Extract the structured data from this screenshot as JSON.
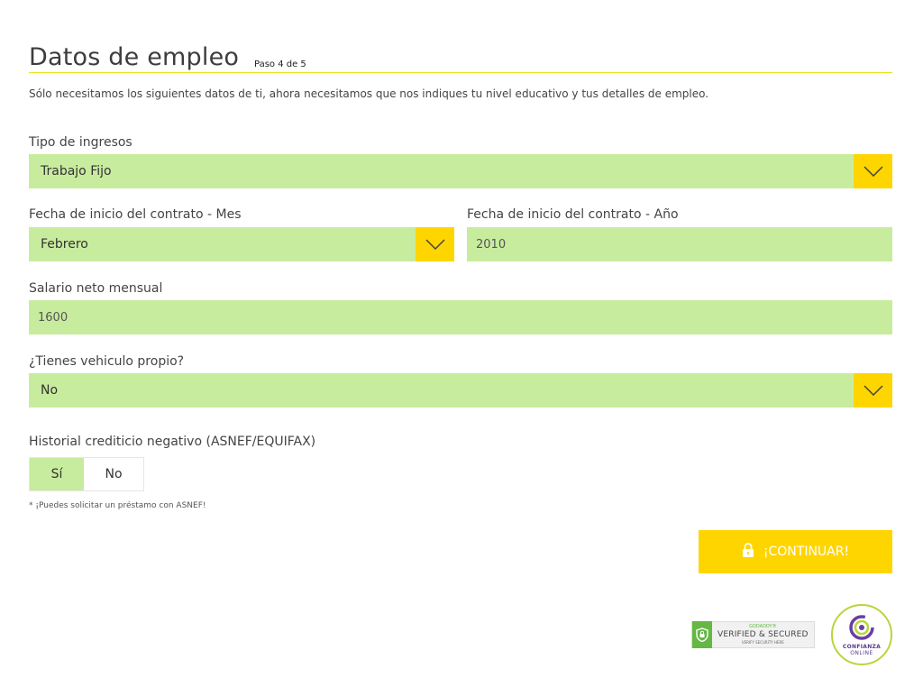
{
  "header": {
    "title": "Datos de empleo",
    "step": "Paso 4 de 5",
    "intro": "Sólo necesitamos los siguientes datos de ti, ahora necesitamos que nos indiques tu nivel educativo y tus detalles de empleo."
  },
  "form": {
    "tipo_ingresos": {
      "label": "Tipo de ingresos",
      "value": "Trabajo Fijo"
    },
    "mes_inicio": {
      "label": "Fecha de inicio del contrato - Mes",
      "value": "Febrero"
    },
    "anio_inicio": {
      "label": "Fecha de inicio del contrato - Año",
      "value": "2010"
    },
    "salario": {
      "label": "Salario neto mensual",
      "value": "1600"
    },
    "vehiculo": {
      "label": "¿Tienes vehiculo propio?",
      "value": "No"
    },
    "historial": {
      "label": "Historial crediticio negativo (ASNEF/EQUIFAX)",
      "options": [
        "Sí",
        "No"
      ],
      "selected": "Sí"
    },
    "note": "* ¡Puedes solicitar un préstamo con ASNEF!"
  },
  "actions": {
    "continue_label": "¡CONTINUAR!"
  },
  "badges": {
    "godaddy_brand": "GODADDY®",
    "godaddy_main": "VERIFIED & SECURED",
    "godaddy_sub": "VERIFY SECURITY HERE",
    "confianza_line1": "CONFIANZA",
    "confianza_line2": "ONLINE"
  },
  "colors": {
    "field_bg": "#c8ec9e",
    "accent": "#ffd500",
    "rule": "#e6e61a"
  },
  "icons": {
    "dropdown": "chevron-down-icon",
    "button": "lock-icon"
  }
}
